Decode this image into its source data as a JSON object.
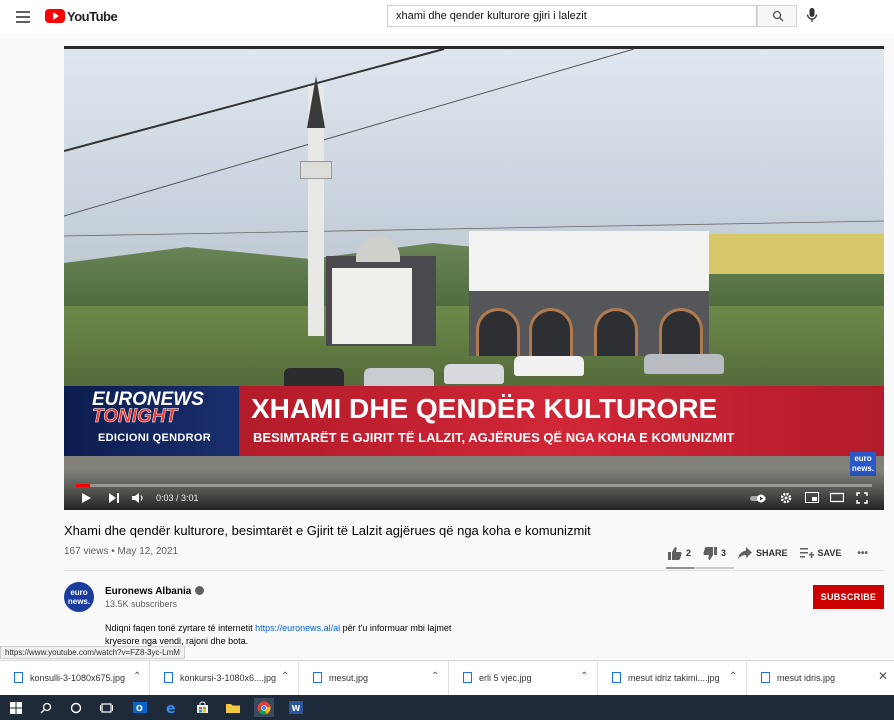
{
  "masthead": {
    "logo_text": "YouTube",
    "search_value": "xhami dhe qender kulturore gjiri i lalezit"
  },
  "player": {
    "lower_third": {
      "brand_line1": "EURONEWS",
      "brand_line2": "TONIGHT",
      "edition": "EDICIONI QENDROR",
      "headline": "XHAMI DHE QENDËR KULTURORE",
      "subline": "BESIMTARËT E GJIRIT TË LALZIT, AGJËRUES QË NGA KOHA E KOMUNIZMIT",
      "badge": "euro news."
    },
    "time": "0:03 / 3:01",
    "progress_fraction": 0.017
  },
  "video": {
    "title": "Xhami dhe qendër kulturore, besimtarët e Gjirit të Lalzit agjërues që nga koha e komunizmit",
    "meta": "167 views • May 12, 2021",
    "likes": "2",
    "dislikes": "3",
    "share_label": "SHARE",
    "save_label": "SAVE",
    "more_label": "•••"
  },
  "channel": {
    "avatar_text": "euro news.",
    "name": "Euronews Albania",
    "subscribers": "13.5K subscribers",
    "subscribe_label": "SUBSCRIBE",
    "desc_before": "Ndiqni faqen tonë zyrtare të internetit ",
    "desc_link": "https://euronews.al/al",
    "desc_after": " për t'u informuar mbi lajmet",
    "desc_line2": "kryesore nga vendi, rajoni dhe bota."
  },
  "status_url": "https://www.youtube.com/watch?v=FZ8-3yc-LmM",
  "downloads": [
    {
      "label": "konsulli-3-1080x675.jpg"
    },
    {
      "label": "konkursi-3-1080x6....jpg"
    },
    {
      "label": "mesut.jpg"
    },
    {
      "label": "erli 5 vjec.jpg"
    },
    {
      "label": "mesut idriz takimi....jpg"
    },
    {
      "label": "mesut idris.jpg"
    }
  ],
  "colors": {
    "yt_red": "#ff0000",
    "subscribe_red": "#cc0000",
    "link_blue": "#065fd4",
    "lower_third_red": "#d02737",
    "lower_third_navy": "#0b1d4f",
    "taskbar": "#1e2a3a"
  },
  "icons": [
    "menu-icon",
    "search-icon",
    "mic-icon",
    "play-icon",
    "next-icon",
    "volume-icon",
    "autoplay-toggle",
    "settings-icon",
    "miniplayer-icon",
    "theater-icon",
    "fullscreen-icon",
    "thumbs-up-icon",
    "thumbs-down-icon",
    "share-icon",
    "save-icon",
    "verified-icon",
    "file-icon",
    "windows-icon",
    "taskbar-search-icon",
    "cortana-icon",
    "task-view-icon",
    "outlook-icon",
    "edge-icon",
    "store-icon",
    "explorer-icon",
    "chrome-icon",
    "word-icon"
  ]
}
